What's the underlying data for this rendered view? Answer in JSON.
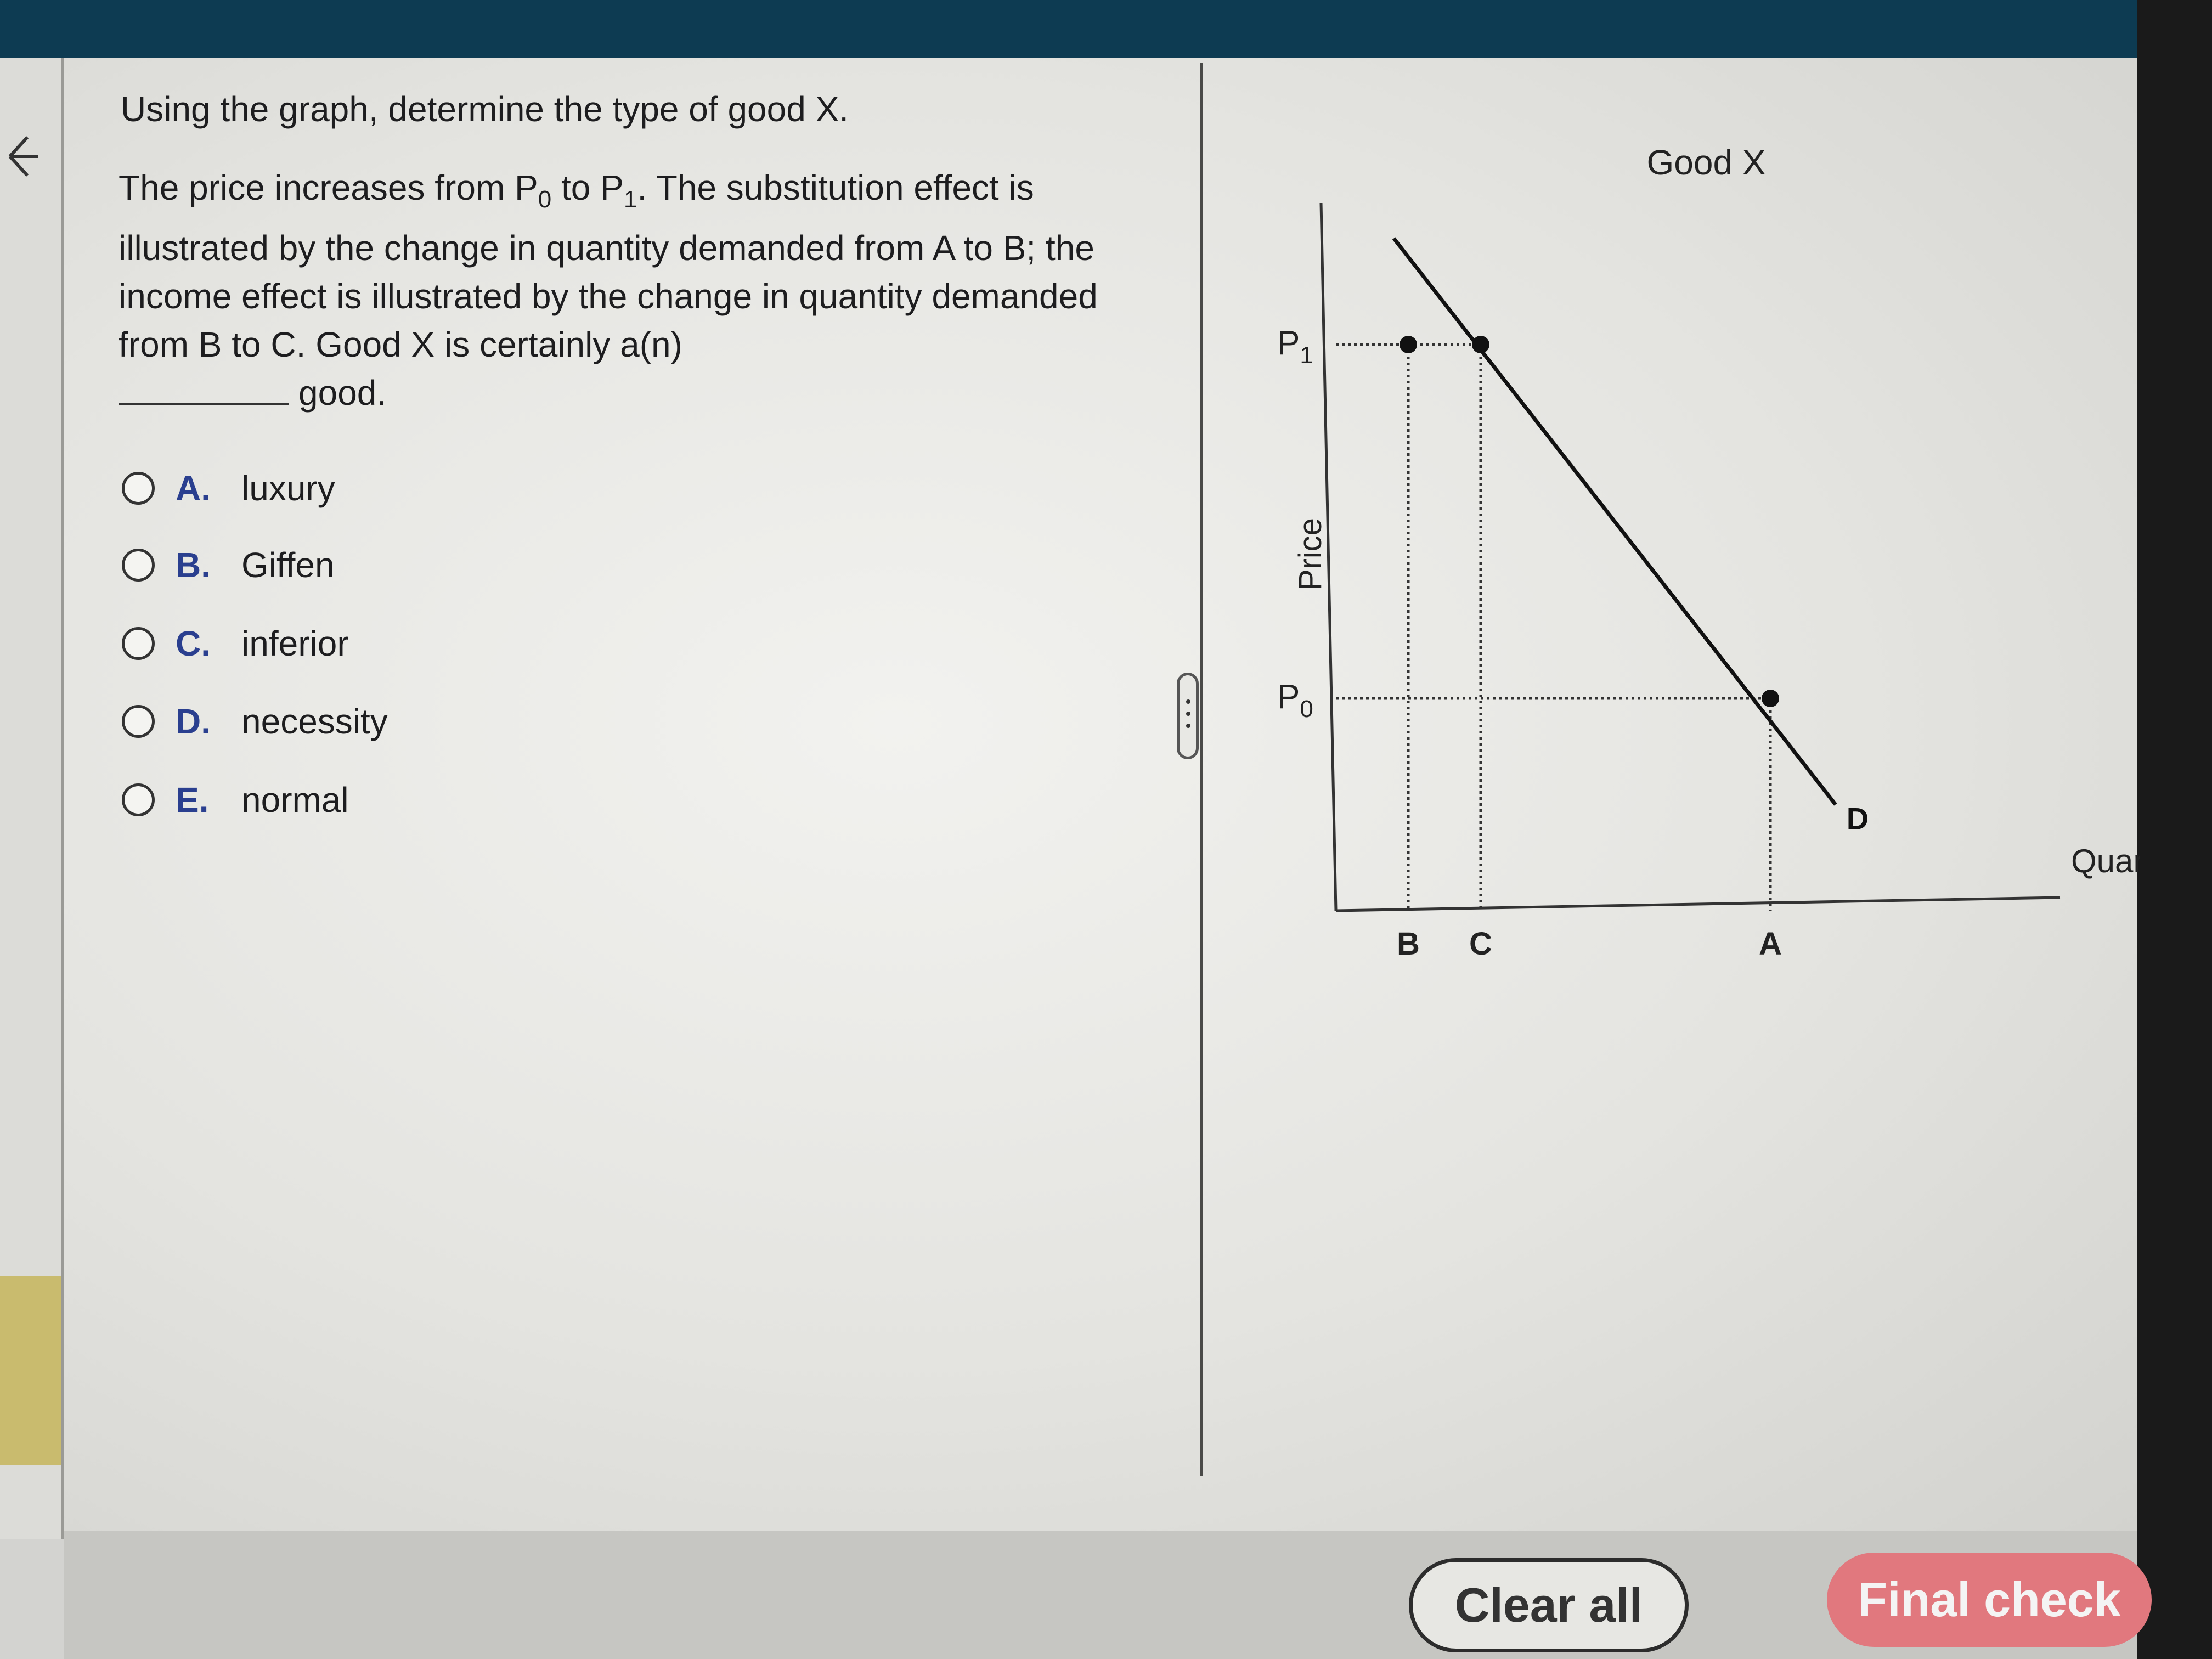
{
  "question": {
    "title": "Using the graph, determine the type of good X.",
    "body": {
      "t1": "The price increases from P",
      "s1": "0",
      "t2": " to P",
      "s2": "1",
      "t3": ". The substitution effect is illustrated by the change in quantity demanded from A to B; the income effect is illustrated by the change in quantity demanded from B to C. Good X is certainly a(n)",
      "t4": "good."
    },
    "options": [
      {
        "letter": "A.",
        "text": "luxury"
      },
      {
        "letter": "B.",
        "text": "Giffen"
      },
      {
        "letter": "C.",
        "text": "inferior"
      },
      {
        "letter": "D.",
        "text": "necessity"
      },
      {
        "letter": "E.",
        "text": "normal"
      }
    ]
  },
  "chart_data": {
    "type": "line",
    "title": "Good X",
    "xlabel": "Quar",
    "ylabel": "Price",
    "y_ticks": [
      {
        "main": "P",
        "sub": "1",
        "value": 0.8
      },
      {
        "main": "P",
        "sub": "0",
        "value": 0.3
      }
    ],
    "x_ticks": [
      {
        "label": "B",
        "value": 0.1
      },
      {
        "label": "C",
        "value": 0.2
      },
      {
        "label": "A",
        "value": 0.6
      }
    ],
    "series": [
      {
        "name": "D",
        "x": [
          0.08,
          0.69
        ],
        "y": [
          0.95,
          0.15
        ]
      }
    ],
    "points": [
      {
        "x": 0.1,
        "y": 0.8
      },
      {
        "x": 0.2,
        "y": 0.8
      },
      {
        "x": 0.6,
        "y": 0.3
      }
    ],
    "xlim": [
      0,
      1
    ],
    "ylim": [
      0,
      1
    ],
    "grid": false
  },
  "buttons": {
    "clear_all": "Clear all",
    "final_check": "Final check"
  },
  "colors": {
    "header": "#0d3b52",
    "final_check": "#e1787e",
    "option_letter": "#2a3f8f"
  },
  "icons": {
    "back": "arrow-left-icon",
    "splitter": "drag-handle-icon"
  }
}
